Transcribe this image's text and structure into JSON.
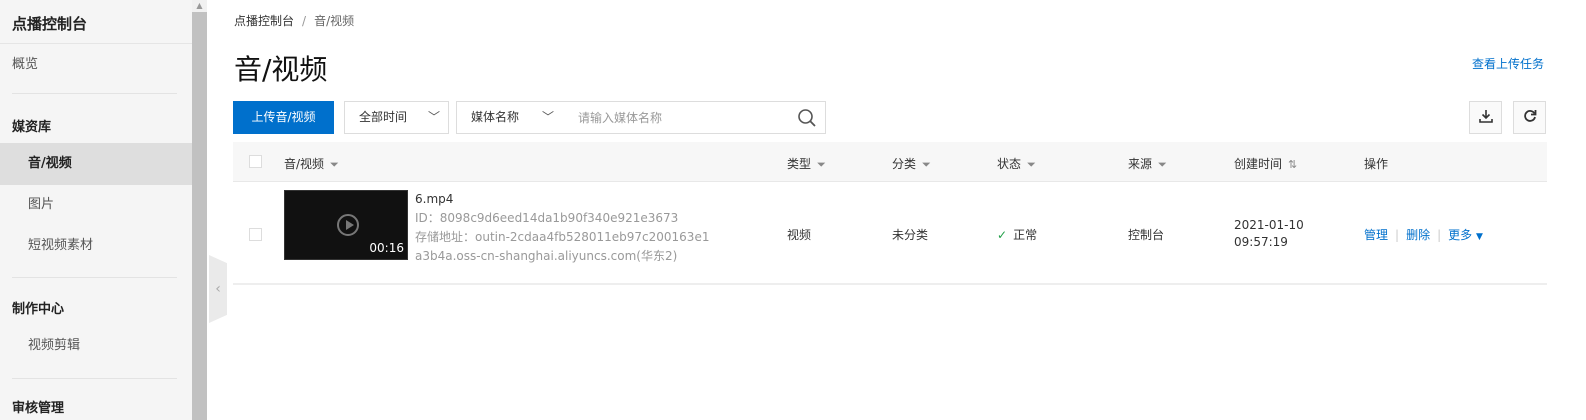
{
  "sidebar": {
    "title": "点播控制台",
    "overview": "概览",
    "groups": [
      {
        "label": "媒资库",
        "items": [
          "音/视频",
          "图片",
          "短视频素材"
        ]
      },
      {
        "label": "制作中心",
        "items": [
          "视频剪辑"
        ]
      },
      {
        "label": "审核管理",
        "items": []
      }
    ],
    "active_item": "音/视频"
  },
  "breadcrumb": [
    "点播控制台",
    "音/视频"
  ],
  "breadcrumb_separator": "/",
  "page_title": "音/视频",
  "view_upload_tasks": "查看上传任务",
  "toolbar": {
    "upload_label": "上传音/视频",
    "time_filter": "全部时间",
    "search_field": "媒体名称",
    "search_placeholder": "请输入媒体名称",
    "search_value": ""
  },
  "table": {
    "headers": [
      "音/视频",
      "类型",
      "分类",
      "状态",
      "来源",
      "创建时间",
      "操作"
    ],
    "rows": [
      {
        "name": "6.mp4",
        "id": "ID：8098c9d6eed14da1b90f340e921e3673",
        "storage": "存储地址：outin-2cdaa4fb528011eb97c200163e1a3b4a.oss-cn-shanghai.aliyuncs.com(华东2)",
        "duration": "00:16",
        "type": "视频",
        "category": "未分类",
        "status": "正常",
        "source": "控制台",
        "created_date": "2021-01-10",
        "created_time": "09:57:19",
        "actions": [
          "管理",
          "删除",
          "更多"
        ]
      }
    ]
  },
  "colors": {
    "primary": "#0070cc",
    "status_ok": "#22a049"
  }
}
